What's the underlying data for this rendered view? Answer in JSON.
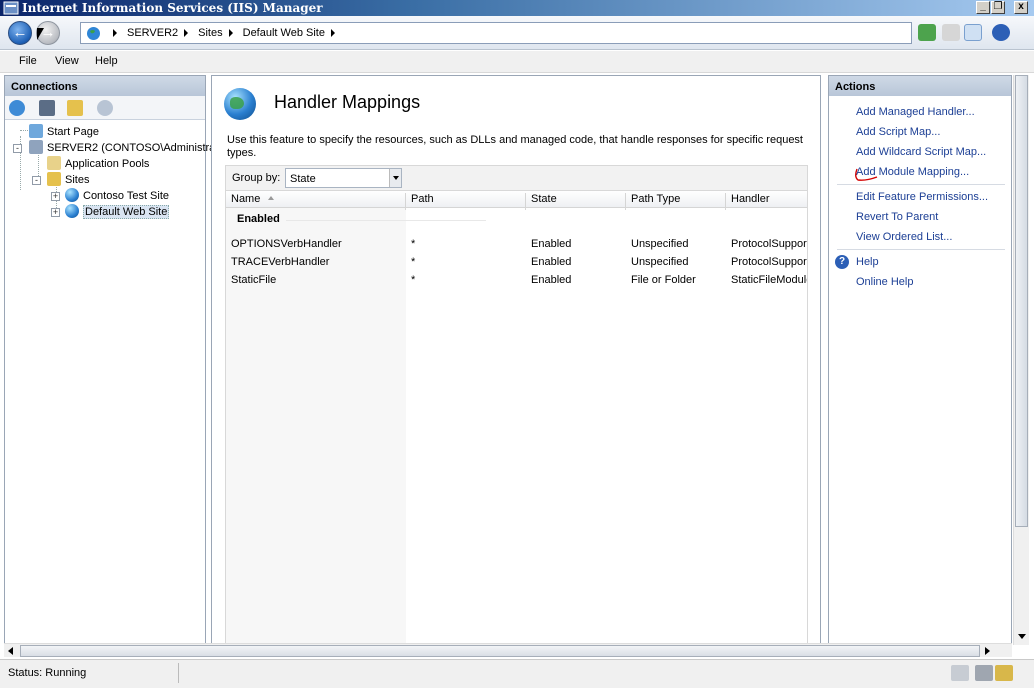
{
  "window": {
    "title": "Internet Information Services (IIS) Manager",
    "minimize": "_",
    "restore": "❐",
    "close": "x"
  },
  "address": {
    "crumbs": [
      "SERVER2",
      "Sites",
      "Default Web Site"
    ]
  },
  "menu": {
    "file": "File",
    "view": "View",
    "help": "Help"
  },
  "connections": {
    "title": "Connections",
    "tree": {
      "start_page": "Start Page",
      "server": "SERVER2 (CONTOSO\\Administra",
      "app_pools": "Application Pools",
      "sites": "Sites",
      "site1": "Contoso Test Site",
      "site2": "Default Web Site"
    }
  },
  "feature": {
    "title": "Handler Mappings",
    "description": "Use this feature to specify the resources, such as DLLs and managed code, that handle responses for specific request types.",
    "group_by_label": "Group by:",
    "group_by_value": "State",
    "columns": [
      "Name",
      "Path",
      "State",
      "Path Type",
      "Handler"
    ],
    "group_header": "Enabled",
    "rows": [
      [
        "OPTIONSVerbHandler",
        "*",
        "Enabled",
        "Unspecified",
        "ProtocolSupport"
      ],
      [
        "TRACEVerbHandler",
        "*",
        "Enabled",
        "Unspecified",
        "ProtocolSupport"
      ],
      [
        "StaticFile",
        "*",
        "Enabled",
        "File or Folder",
        "StaticFileModule"
      ]
    ]
  },
  "actions": {
    "title": "Actions",
    "add_managed_handler": "Add Managed Handler...",
    "add_script_map": "Add Script Map...",
    "add_wildcard_script_map": "Add Wildcard Script Map...",
    "add_module_mapping": "Add Module Mapping...",
    "edit_feature_permissions": "Edit Feature Permissions...",
    "revert_to_parent": "Revert To Parent",
    "view_ordered_list": "View Ordered List...",
    "help": "Help",
    "online_help": "Online Help"
  },
  "status": {
    "text": "Status: Running"
  },
  "colors": {
    "link": "#1c3f95",
    "panel_header": "#b8c6d8",
    "annotation": "#d40000"
  }
}
